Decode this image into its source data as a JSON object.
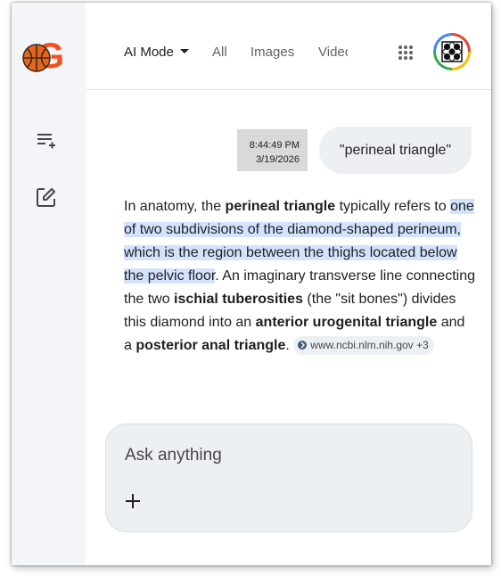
{
  "nav": {
    "ai_mode": "AI Mode",
    "all": "All",
    "images": "Images",
    "videos": "Videos"
  },
  "sidebar": {
    "logo_letter": "G",
    "items": [
      {
        "icon": "new-chat-list-icon"
      },
      {
        "icon": "edit-square-icon"
      }
    ]
  },
  "header": {
    "apps_icon": "apps-grid-icon",
    "avatar_icon": "quincunx-tile-icon"
  },
  "conversation": {
    "timestamp_time": "8:44:49 PM",
    "timestamp_date": "3/19/2026",
    "query": "\"perineal triangle\"",
    "answer": {
      "t1": "In anatomy, the ",
      "b1": "perineal triangle",
      "t2": " typically refers to ",
      "highlight": "one of two subdivisions of the diamond-shaped perineum, which is the region between the thighs located below the pelvic floor",
      "t3": ". An imaginary transverse line connecting the two ",
      "b2": "ischial tuberosities",
      "t4": " (the \"sit bones\") divides this diamond into an ",
      "b3": "anterior urogenital triangle",
      "t5": " and a ",
      "b4": "posterior anal triangle",
      "t6": ". ",
      "source": "www.ncbi.nlm.nih.gov +3"
    }
  },
  "input": {
    "placeholder": "Ask anything"
  },
  "colors": {
    "sidebar_bg": "#f3f5f8",
    "highlight": "#d3e3fd",
    "bubble_bg": "#edf0f3",
    "logo_orange": "#f4511e",
    "timestamp_bg": "#d9d9d9"
  }
}
